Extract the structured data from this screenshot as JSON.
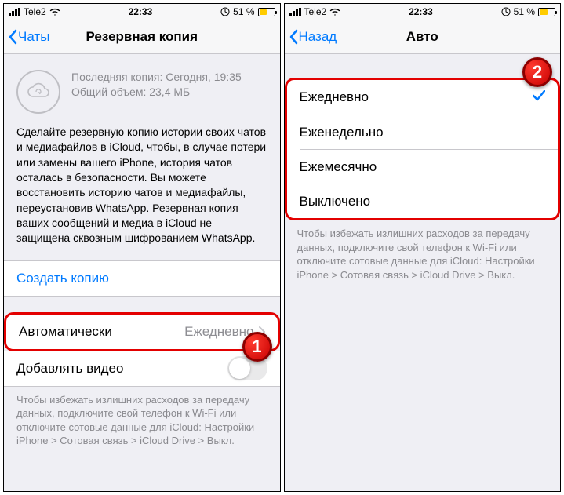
{
  "statusbar": {
    "carrier": "Tele2",
    "time": "22:33",
    "battery_pct": "51 %"
  },
  "phone1": {
    "nav": {
      "back": "Чаты",
      "title": "Резервная копия"
    },
    "info": {
      "last": "Последняя копия: Сегодня, 19:35",
      "size": "Общий объем: 23,4 МБ"
    },
    "desc": "Сделайте резервную копию истории своих чатов и медиафайлов в iCloud, чтобы, в случае потери или замены вашего iPhone, история чатов осталась в безопасности. Вы можете восстановить историю чатов и медиафайлы, переустановив WhatsApp. Резервная копия ваших сообщений и медиа в iCloud не защищена сквозным шифрованием WhatsApp.",
    "create": "Создать копию",
    "auto_label": "Автоматически",
    "auto_value": "Ежедневно",
    "video_label": "Добавлять видео",
    "footer": "Чтобы избежать излишних расходов за передачу данных, подключите свой телефон к Wi-Fi или отключите сотовые данные для iCloud: Настройки iPhone > Сотовая связь > iCloud Drive > Выкл."
  },
  "phone2": {
    "nav": {
      "back": "Назад",
      "title": "Авто"
    },
    "opts": {
      "o0": "Ежедневно",
      "o1": "Еженедельно",
      "o2": "Ежемесячно",
      "o3": "Выключено"
    },
    "footer": "Чтобы избежать излишних расходов за передачу данных, подключите свой телефон к Wi-Fi или отключите сотовые данные для iCloud: Настройки iPhone > Сотовая связь > iCloud Drive > Выкл."
  },
  "markers": {
    "m1": "1",
    "m2": "2"
  }
}
